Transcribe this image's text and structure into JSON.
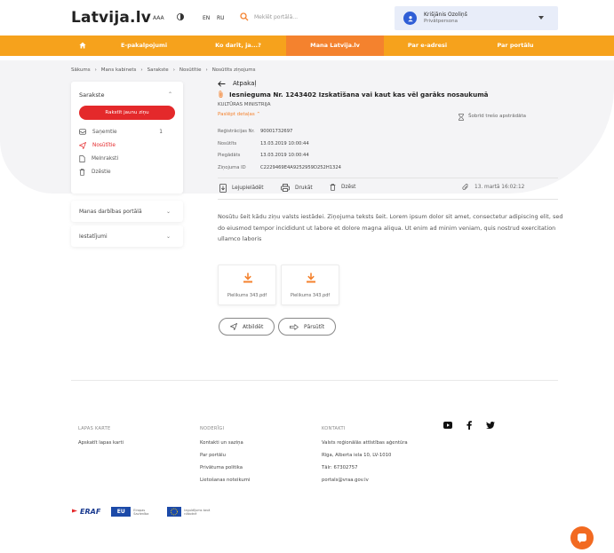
{
  "header": {
    "logo_text_a": "Latvi",
    "logo_text_b": "ja.lv",
    "font_size_label": "AAA",
    "lang_en": "EN",
    "lang_ru": "RU",
    "search_placeholder": "Meklēt portālā...",
    "user_name": "Krišjānis Ozoliņš",
    "user_role": "Privātpersona"
  },
  "nav": {
    "items": [
      {
        "label": "E-pakalpojumi"
      },
      {
        "label": "Ko darīt, ja...?"
      },
      {
        "label": "Mana Latvija.lv"
      },
      {
        "label": "Par e-adresi"
      },
      {
        "label": "Par portālu"
      }
    ]
  },
  "breadcrumbs": [
    "Sākums",
    "Mans kabinets",
    "Sarakste",
    "Nosūtītie",
    "Nosūtīts ziņojums"
  ],
  "sidebar": {
    "title": "Sarakste",
    "new_message": "Rakstīt jaunu ziņu",
    "items": [
      {
        "label": "Saņemtie",
        "count": "1"
      },
      {
        "label": "Nosūtītie",
        "count": ""
      },
      {
        "label": "Melnraksti",
        "count": ""
      },
      {
        "label": "Dzēstie",
        "count": ""
      }
    ],
    "activity": "Manas darbības portālā",
    "settings": "Iestatījumi"
  },
  "message": {
    "back": "Atpakaļ",
    "title": "Iesnieguma Nr. 1243402 Izskatīšana vai kaut kas vēl garāks nosaukumā",
    "ministry": "KULTŪRAS MINISTRIJA",
    "hide_details": "Paslēpt detaļas",
    "sent_all": "Šobrīd trešo apstrādāta",
    "meta": [
      {
        "k": "Reģistrācijas Nr.",
        "v": "90001732697"
      },
      {
        "k": "Nosūtīts",
        "v": "13.03.2019  10:00:44"
      },
      {
        "k": "Piegādāts",
        "v": "13.03.2019  10:00:44"
      },
      {
        "k": "Ziņojuma ID",
        "v": "C2229469E4A9252959D252H1324"
      }
    ],
    "actions": {
      "download": "Lejupielādēt",
      "print": "Drukāt",
      "delete": "Dzēst",
      "date": "13. martā  16:02:12"
    },
    "body": "Nosūtu šeit kādu ziņu valsts iestādei. Ziņojuma teksts šeit. Lorem ipsum dolor sit amet, consectetur adipiscing elit, sed do eiusmod tempor incididunt ut labore et dolore magna aliqua. Ut enim ad minim veniam, quis nostrud exercitation ullamco laboris",
    "attachments": [
      {
        "name": "Pielikums 343.pdf"
      },
      {
        "name": "Pielikums 343.pdf"
      }
    ],
    "reply": "Atbildēt",
    "forward": "Pārsūtīt"
  },
  "footer": {
    "col1_head": "LAPAS KARTE",
    "col1_items": [
      "Apskatīt lapas karti"
    ],
    "col2_head": "NODERĪGI",
    "col2_items": [
      "Kontakti un saziņa",
      "Par portālu",
      "Privātuma politika",
      "Lietošanas noteikumi"
    ],
    "col3_head": "KONTAKTI",
    "col3_items": [
      "Valsts reģionālās attīstības aģentūra",
      "Rīga, Alberta iela 10, LV-1010",
      "Tālr: 67302757",
      "portals@vraa.gov.lv"
    ],
    "logo_eraf": "ERAF",
    "logo_eu": "EU",
    "logo_eu_text": "Eiropas Savienība",
    "logo_fund": "Ieguldījums tavā nākotnē"
  },
  "colors": {
    "nav": "#f6a21c",
    "nav_active": "#f4822e",
    "accent_red": "#e4292b",
    "user_bg": "#e8edf9"
  }
}
